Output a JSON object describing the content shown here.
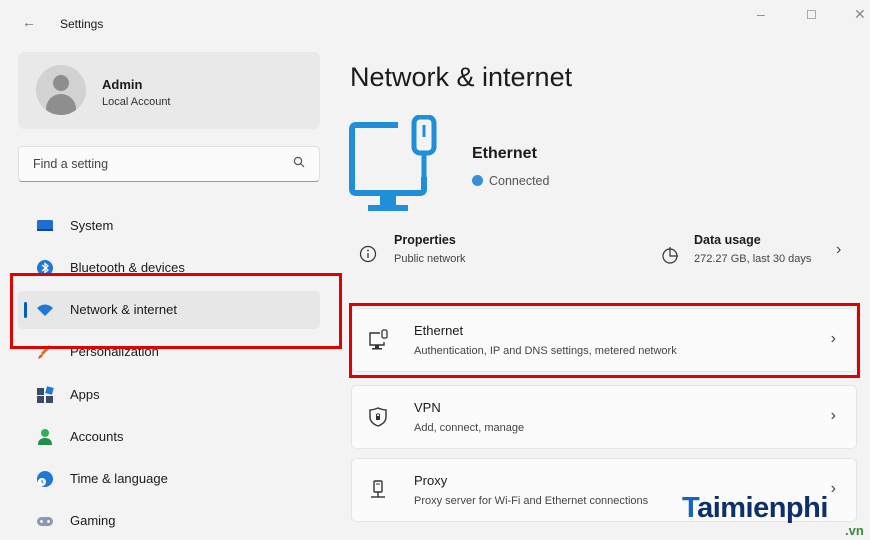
{
  "window": {
    "title": "Settings",
    "back_glyph": "←",
    "minimize": "–",
    "maximize": "☐",
    "close": "✕"
  },
  "profile": {
    "name": "Admin",
    "account_type": "Local Account"
  },
  "search": {
    "placeholder": "Find a setting"
  },
  "nav": {
    "items": [
      {
        "label": "System",
        "icon": "system-icon"
      },
      {
        "label": "Bluetooth & devices",
        "icon": "bluetooth-icon"
      },
      {
        "label": "Network & internet",
        "icon": "wifi-icon",
        "selected": true
      },
      {
        "label": "Personalization",
        "icon": "paintbrush-icon"
      },
      {
        "label": "Apps",
        "icon": "apps-icon"
      },
      {
        "label": "Accounts",
        "icon": "person-icon"
      },
      {
        "label": "Time & language",
        "icon": "globe-clock-icon"
      },
      {
        "label": "Gaming",
        "icon": "gamepad-icon"
      }
    ]
  },
  "main": {
    "title": "Network & internet",
    "connection": {
      "name": "Ethernet",
      "status": "Connected"
    },
    "properties": {
      "title": "Properties",
      "subtitle": "Public network"
    },
    "data_usage": {
      "title": "Data usage",
      "subtitle": "272.27 GB, last 30 days"
    },
    "cards": [
      {
        "title": "Ethernet",
        "subtitle": "Authentication, IP and DNS settings, metered network",
        "icon": "ethernet-icon"
      },
      {
        "title": "VPN",
        "subtitle": "Add, connect, manage",
        "icon": "vpn-shield-icon"
      },
      {
        "title": "Proxy",
        "subtitle": "Proxy server for Wi-Fi and Ethernet connections",
        "icon": "proxy-icon"
      }
    ],
    "chevron": "›"
  },
  "watermark": {
    "initial": "T",
    "text": "aimienphi",
    "suffix": ".vn"
  },
  "colors": {
    "accent": "#005fb8",
    "highlight_box": "#e00000",
    "hero_icon": "#1e8fd8"
  }
}
